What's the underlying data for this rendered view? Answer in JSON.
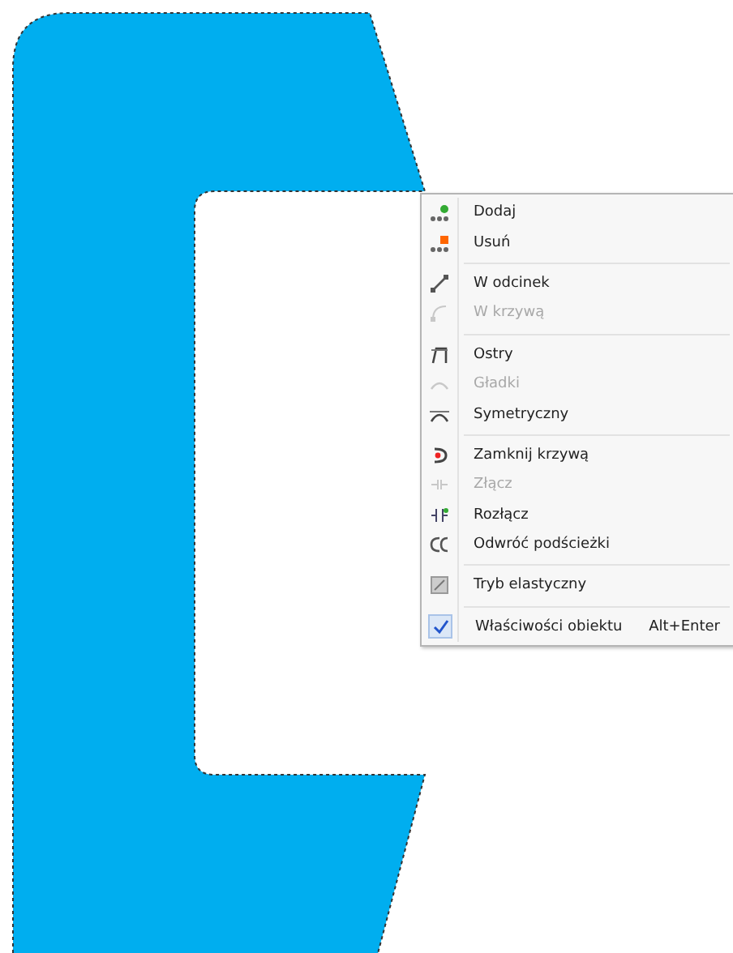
{
  "canvas": {
    "shape": {
      "color": "#00aeef"
    }
  },
  "context_menu": {
    "items": [
      {
        "kind": "item",
        "label": "Dodaj",
        "disabled": false
      },
      {
        "kind": "item",
        "label": "Usuń",
        "disabled": false
      },
      {
        "kind": "separator"
      },
      {
        "kind": "item",
        "label": "W odcinek",
        "disabled": false
      },
      {
        "kind": "item",
        "label": "W krzywą",
        "disabled": true
      },
      {
        "kind": "separator"
      },
      {
        "kind": "item",
        "label": "Ostry",
        "disabled": false
      },
      {
        "kind": "item",
        "label": "Gładki",
        "disabled": true
      },
      {
        "kind": "item",
        "label": "Symetryczny",
        "disabled": false
      },
      {
        "kind": "separator"
      },
      {
        "kind": "item",
        "label": "Zamknij krzywą",
        "disabled": false
      },
      {
        "kind": "item",
        "label": "Złącz",
        "disabled": true
      },
      {
        "kind": "item",
        "label": "Rozłącz",
        "disabled": false
      },
      {
        "kind": "item",
        "label": "Odwróć podścieżki",
        "disabled": false
      },
      {
        "kind": "separator"
      },
      {
        "kind": "item",
        "label": "Tryb elastyczny",
        "disabled": false,
        "checked": false
      },
      {
        "kind": "separator"
      },
      {
        "kind": "item",
        "label": "Właściwości obiektu",
        "disabled": false,
        "checked": true,
        "shortcut": "Alt+Enter"
      }
    ]
  }
}
